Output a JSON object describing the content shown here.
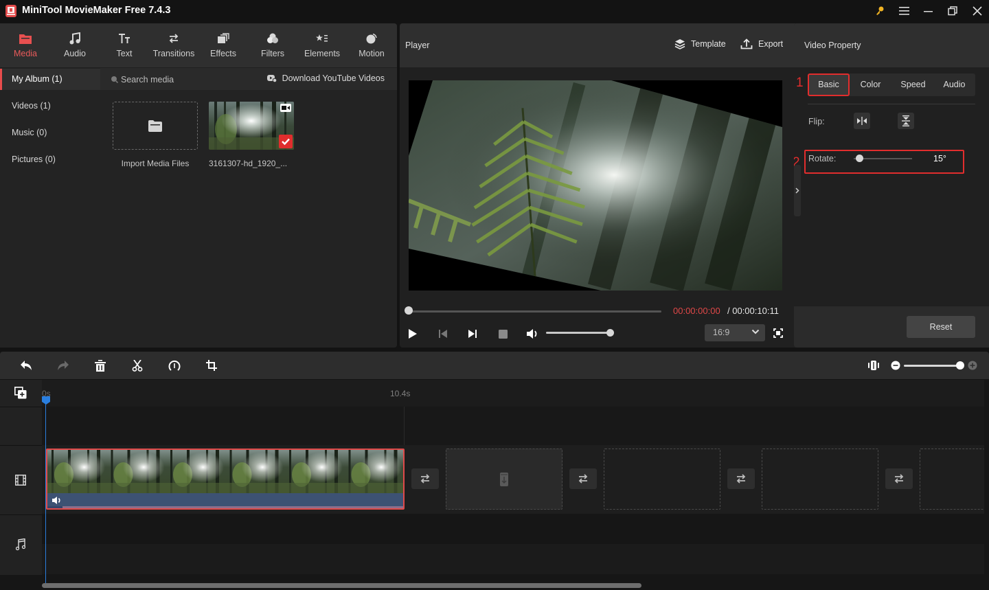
{
  "app": {
    "title": "MiniTool MovieMaker Free 7.4.3"
  },
  "window_controls": [
    "key-icon",
    "menu-icon",
    "minimize-icon",
    "restore-icon",
    "close-icon"
  ],
  "toolbar": {
    "tabs": [
      {
        "label": "Media",
        "icon": "folder-icon",
        "active": true
      },
      {
        "label": "Audio",
        "icon": "music-note-icon"
      },
      {
        "label": "Text",
        "icon": "text-icon"
      },
      {
        "label": "Transitions",
        "icon": "transition-arrows-icon"
      },
      {
        "label": "Effects",
        "icon": "effects-icon"
      },
      {
        "label": "Filters",
        "icon": "filters-icon"
      },
      {
        "label": "Elements",
        "icon": "elements-icon"
      },
      {
        "label": "Motion",
        "icon": "motion-icon"
      }
    ]
  },
  "album": {
    "items": [
      {
        "label": "My Album (1)",
        "active": true
      },
      {
        "label": "Videos (1)"
      },
      {
        "label": "Music (0)"
      },
      {
        "label": "Pictures (0)"
      }
    ]
  },
  "media": {
    "search_placeholder": "Search media",
    "download_label": "Download YouTube Videos",
    "import_label": "Import Media Files",
    "files": [
      {
        "name": "3161307-hd_1920_...",
        "selected": true
      }
    ]
  },
  "player": {
    "title": "Player",
    "template_label": "Template",
    "export_label": "Export",
    "time_current": "00:00:00:00",
    "time_separator": " / ",
    "time_total": "00:00:10:11",
    "progress": 0,
    "volume": 1.0,
    "aspect_ratio": "16:9"
  },
  "property": {
    "title": "Video Property",
    "tabs": [
      {
        "label": "Basic",
        "active": true
      },
      {
        "label": "Color"
      },
      {
        "label": "Speed"
      },
      {
        "label": "Audio"
      }
    ],
    "annotation_1": "1",
    "annotation_2": "2",
    "flip_label": "Flip:",
    "rotate_label": "Rotate:",
    "rotate_value": "15°",
    "rotate_degrees": 15,
    "reset_label": "Reset"
  },
  "timeline": {
    "ruler_start": "0s",
    "ruler_end": "10.4s",
    "zoom_level": 1.0,
    "clip_count": 1,
    "empty_slots": 4
  },
  "colors": {
    "accent": "#e84c4c",
    "playhead": "#2a7fe0",
    "audio_bar": "#3d5273",
    "time_current": "#e04848"
  }
}
